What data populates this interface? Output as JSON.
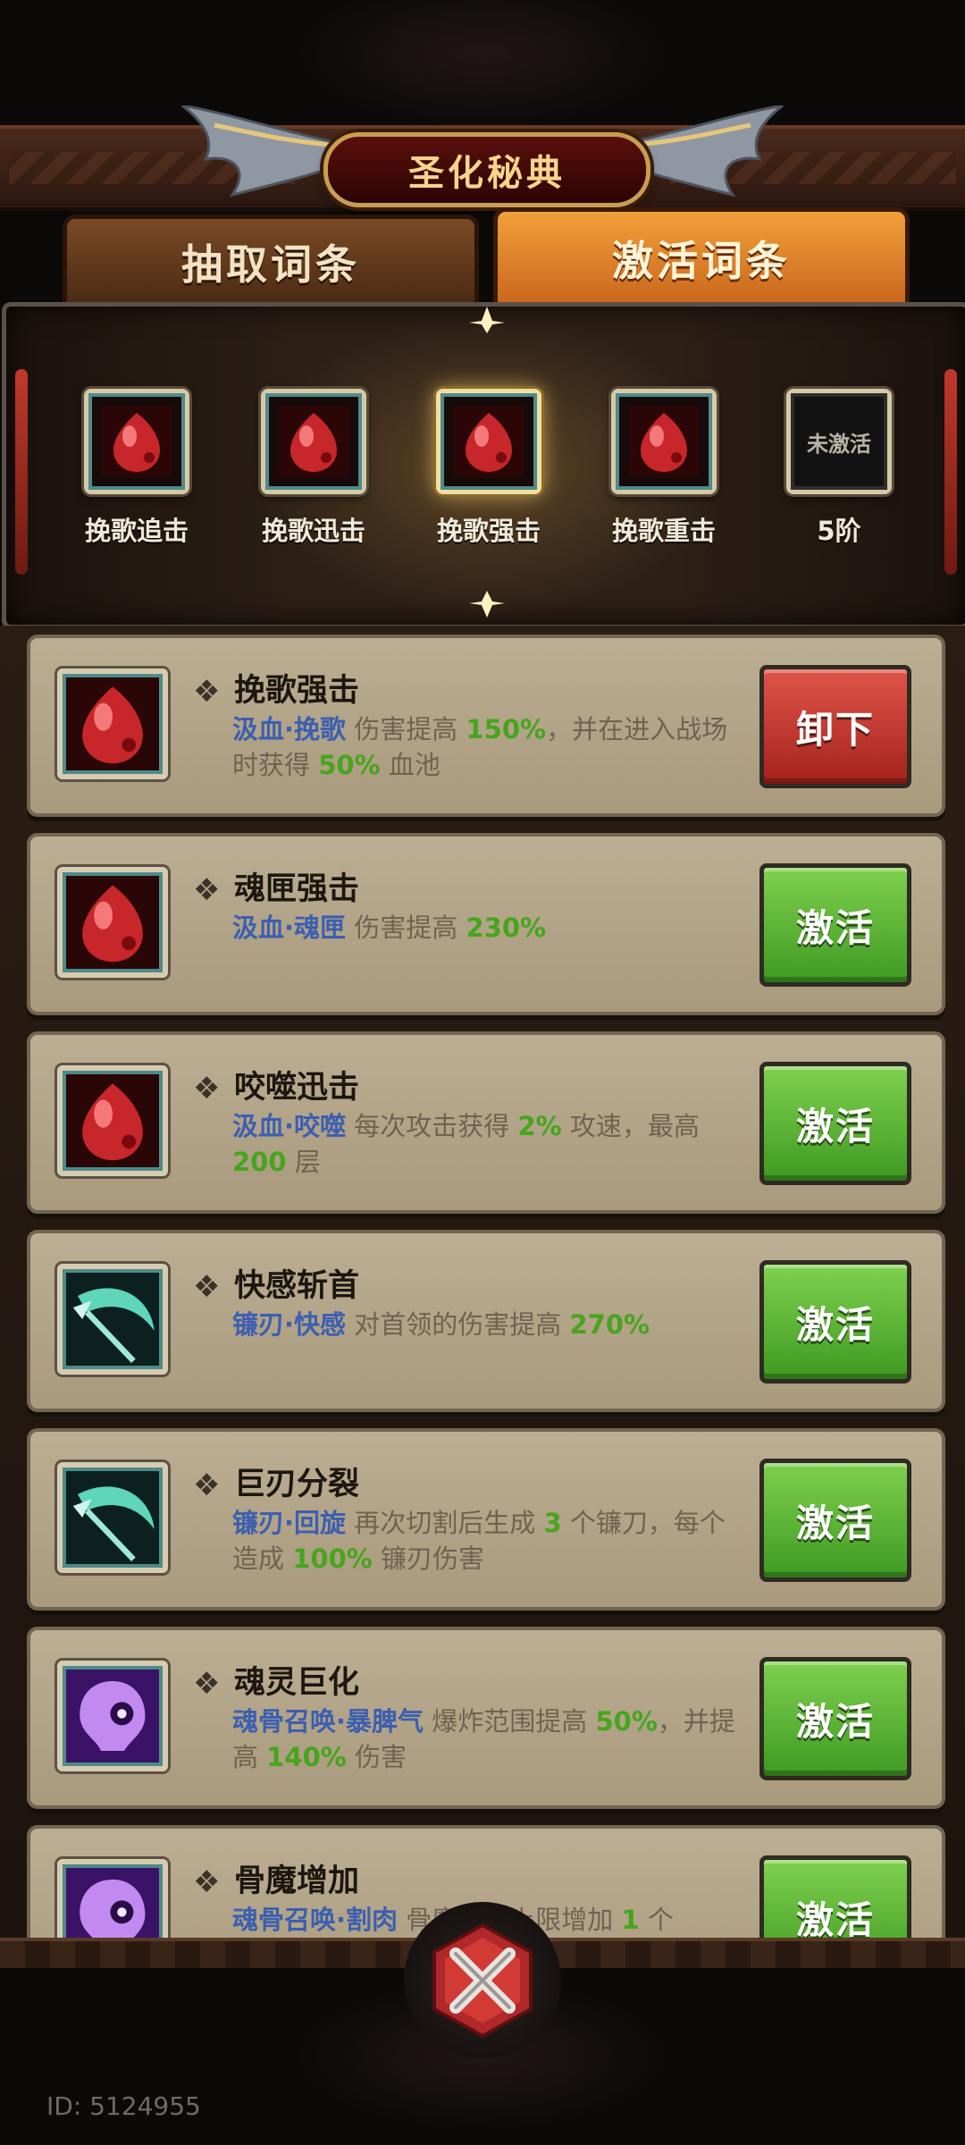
{
  "title": "圣化秘典",
  "tabs": [
    {
      "label": "抽取词条",
      "selected": false
    },
    {
      "label": "激活词条",
      "selected": true
    }
  ],
  "equipped_slots": [
    {
      "label": "挽歌追击",
      "icon": "blood-drop-icon"
    },
    {
      "label": "挽歌迅击",
      "icon": "blood-drop-icon"
    },
    {
      "label": "挽歌强击",
      "icon": "blood-drop-icon",
      "highlighted": true
    },
    {
      "label": "挽歌重击",
      "icon": "blood-drop-icon"
    },
    {
      "label": "5阶",
      "icon": "empty-slot",
      "empty_text": "未激活"
    }
  ],
  "cards": [
    {
      "name": "挽歌强击",
      "icon": "blood-drop-icon",
      "tag": "汲血·挽歌",
      "desc": [
        {
          "t": "伤害提高 "
        },
        {
          "n": "150%"
        },
        {
          "t": "，并在进入战场时获得 "
        },
        {
          "n": "50%"
        },
        {
          "t": " 血池"
        }
      ],
      "button": "卸下",
      "button_color": "#c0392b"
    },
    {
      "name": "魂匣强击",
      "icon": "blood-drop-icon",
      "tag": "汲血·魂匣",
      "desc": [
        {
          "t": "伤害提高 "
        },
        {
          "n": "230%"
        }
      ],
      "button": "激活",
      "button_color": "#4caf2a"
    },
    {
      "name": "咬噬迅击",
      "icon": "blood-drop-icon",
      "tag": "汲血·咬噬",
      "desc": [
        {
          "t": "每次攻击获得 "
        },
        {
          "n": "2%"
        },
        {
          "t": " 攻速，最高 "
        },
        {
          "n": "200"
        },
        {
          "t": " 层"
        }
      ],
      "button": "激活",
      "button_color": "#4caf2a"
    },
    {
      "name": "快感斩首",
      "icon": "scythe-icon",
      "tag": "镰刃·快感",
      "desc": [
        {
          "t": "对首领的伤害提高 "
        },
        {
          "n": "270%"
        }
      ],
      "button": "激活",
      "button_color": "#4caf2a"
    },
    {
      "name": "巨刃分裂",
      "icon": "scythe-icon",
      "tag": "镰刃·回旋",
      "desc": [
        {
          "t": "再次切割后生成 "
        },
        {
          "n": "3"
        },
        {
          "t": " 个镰刀，每个造成 "
        },
        {
          "n": "100%"
        },
        {
          "t": " 镰刃伤害"
        }
      ],
      "button": "激活",
      "button_color": "#4caf2a"
    },
    {
      "name": "魂灵巨化",
      "icon": "skull-spirit-icon",
      "tag": "魂骨召唤·暴脾气",
      "desc": [
        {
          "t": "爆炸范围提高 "
        },
        {
          "n": "50%"
        },
        {
          "t": "，并提高 "
        },
        {
          "n": "140%"
        },
        {
          "t": " 伤害"
        }
      ],
      "button": "激活",
      "button_color": "#4caf2a"
    },
    {
      "name": "骨魔增加",
      "icon": "skull-spirit-icon",
      "tag": "魂骨召唤·割肉",
      "desc": [
        {
          "t": "骨魔数量上限增加 "
        },
        {
          "n": "1"
        },
        {
          "t": " 个"
        }
      ],
      "button": "激活",
      "button_color": "#4caf2a"
    }
  ],
  "footer": {
    "id_text": "ID: 5124955",
    "close_icon": "close-icon"
  }
}
